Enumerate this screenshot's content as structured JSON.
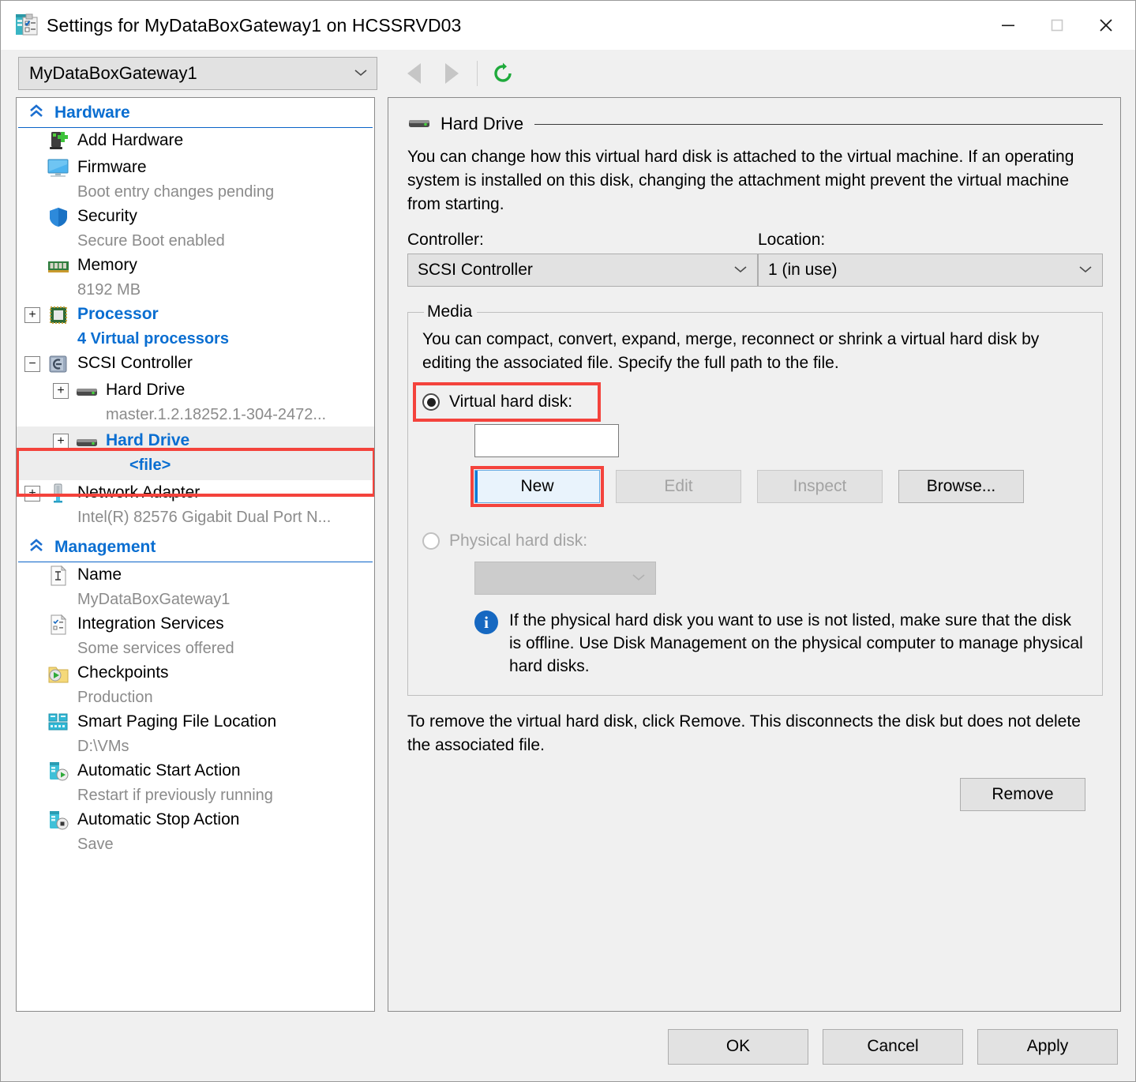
{
  "window": {
    "title": "Settings for MyDataBoxGateway1 on HCSSRVD03",
    "minimize_label": "—",
    "maximize_label": "□",
    "close_label": "✕"
  },
  "toolbar": {
    "vm_selected": "MyDataBoxGateway1",
    "chevron": "⌄",
    "back_tooltip": "Back",
    "forward_tooltip": "Forward",
    "refresh_tooltip": "Refresh"
  },
  "sidebar": {
    "groups": [
      {
        "name": "Hardware",
        "chevron": "«",
        "items": [
          {
            "label": "Add Hardware",
            "sub": "",
            "icon": "add-hardware-icon",
            "expander": "",
            "indent": 0,
            "selected": false
          },
          {
            "label": "Firmware",
            "sub": "Boot entry changes pending",
            "icon": "firmware-icon",
            "expander": "",
            "indent": 0,
            "selected": false
          },
          {
            "label": "Security",
            "sub": "Secure Boot enabled",
            "icon": "security-shield-icon",
            "expander": "",
            "indent": 0,
            "selected": false
          },
          {
            "label": "Memory",
            "sub": "8192 MB",
            "icon": "memory-icon",
            "expander": "",
            "indent": 0,
            "selected": false
          },
          {
            "label": "Processor",
            "sub": "4 Virtual processors",
            "icon": "processor-icon",
            "expander": "+",
            "indent": 0,
            "selected": true
          },
          {
            "label": "SCSI Controller",
            "sub": "",
            "icon": "scsi-controller-icon",
            "expander": "−",
            "indent": 0,
            "selected": false
          },
          {
            "label": "Hard Drive",
            "sub": "master.1.2.18252.1-304-2472...",
            "icon": "hard-drive-icon",
            "expander": "+",
            "indent": 1,
            "selected": false
          },
          {
            "label": "Hard Drive",
            "sub": "<file>",
            "icon": "hard-drive-icon",
            "expander": "+",
            "indent": 1,
            "selected": true,
            "highlighted": true
          },
          {
            "label": "Network Adapter",
            "sub": "Intel(R) 82576 Gigabit Dual Port N...",
            "icon": "network-adapter-icon",
            "expander": "+",
            "indent": 0,
            "selected": false
          }
        ]
      },
      {
        "name": "Management",
        "chevron": "«",
        "items": [
          {
            "label": "Name",
            "sub": "MyDataBoxGateway1",
            "icon": "name-icon",
            "expander": "",
            "indent": 0,
            "selected": false
          },
          {
            "label": "Integration Services",
            "sub": "Some services offered",
            "icon": "integration-services-icon",
            "expander": "",
            "indent": 0,
            "selected": false
          },
          {
            "label": "Checkpoints",
            "sub": "Production",
            "icon": "checkpoints-icon",
            "expander": "",
            "indent": 0,
            "selected": false
          },
          {
            "label": "Smart Paging File Location",
            "sub": "D:\\VMs",
            "icon": "smart-paging-icon",
            "expander": "",
            "indent": 0,
            "selected": false
          },
          {
            "label": "Automatic Start Action",
            "sub": "Restart if previously running",
            "icon": "auto-start-icon",
            "expander": "",
            "indent": 0,
            "selected": false
          },
          {
            "label": "Automatic Stop Action",
            "sub": "Save",
            "icon": "auto-stop-icon",
            "expander": "",
            "indent": 0,
            "selected": false
          }
        ]
      }
    ]
  },
  "main": {
    "section_title": "Hard Drive",
    "description": "You can change how this virtual hard disk is attached to the virtual machine. If an operating system is installed on this disk, changing the attachment might prevent the virtual machine from starting.",
    "controller_label": "Controller:",
    "controller_value": "SCSI Controller",
    "location_label": "Location:",
    "location_value": "1 (in use)",
    "media": {
      "legend": "Media",
      "description": "You can compact, convert, expand, merge, reconnect or shrink a virtual hard disk by editing the associated file. Specify the full path to the file.",
      "virtual_radio_label": "Virtual hard disk:",
      "virtual_path_value": "",
      "virtual_path_placeholder": "",
      "new_label": "New",
      "edit_label": "Edit",
      "inspect_label": "Inspect",
      "browse_label": "Browse...",
      "physical_radio_label": "Physical hard disk:",
      "physical_disk_value": "",
      "info_glyph": "i",
      "info_text": "If the physical hard disk you want to use is not listed, make sure that the disk is offline. Use Disk Management on the physical computer to manage physical hard disks."
    },
    "remove_description": "To remove the virtual hard disk, click Remove. This disconnects the disk but does not delete the associated file.",
    "remove_label": "Remove"
  },
  "footer": {
    "ok_label": "OK",
    "cancel_label": "Cancel",
    "apply_label": "Apply"
  },
  "colors": {
    "accent_blue": "#0a6ed1",
    "highlight_red": "#f4433c",
    "refresh_green": "#1faa3c",
    "info_blue": "#1668c1"
  }
}
